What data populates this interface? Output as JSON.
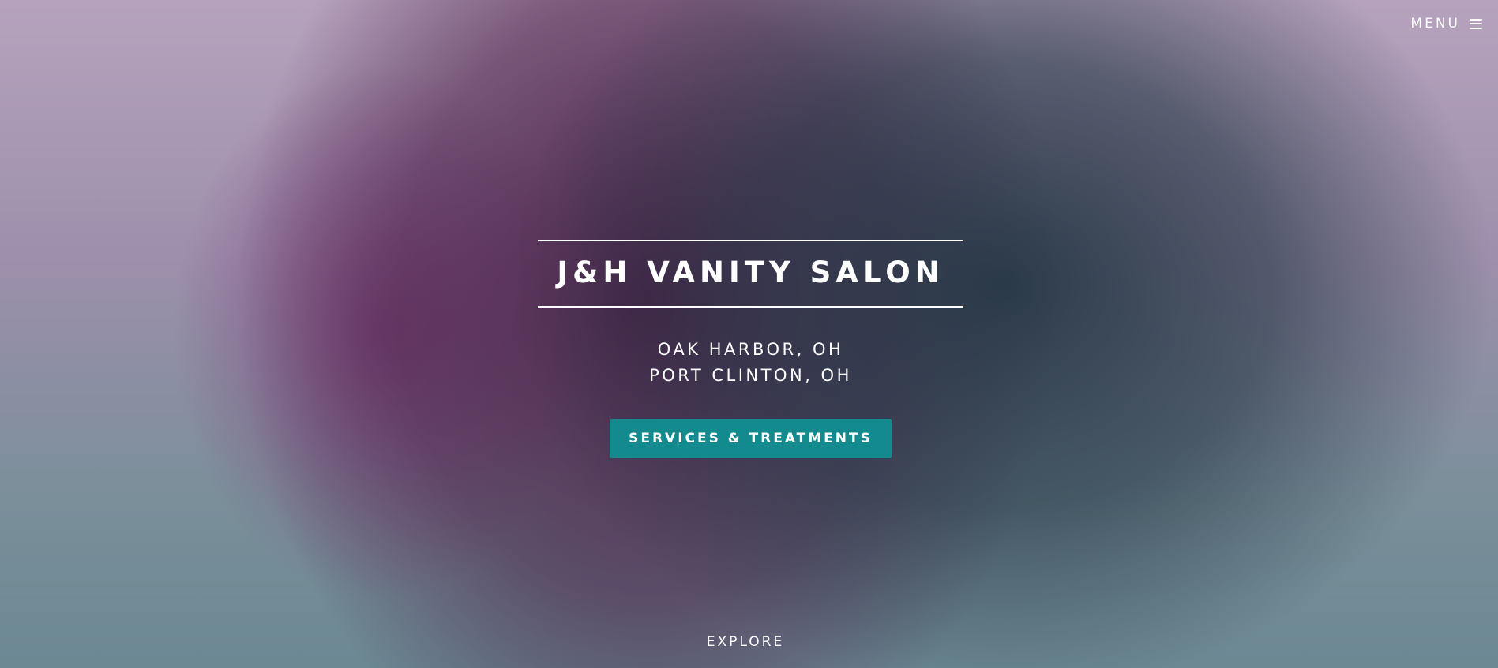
{
  "header": {
    "menu_label": "MENU",
    "menu_icon": "hamburger-icon"
  },
  "hero": {
    "title": "J&H VANITY SALON",
    "locations": [
      "OAK HARBOR, OH",
      "PORT CLINTON, OH"
    ],
    "cta_label": "SERVICES & TREATMENTS",
    "explore_label": "EXPLORE"
  },
  "colors": {
    "accent": "#138a8e",
    "text": "#ffffff"
  }
}
